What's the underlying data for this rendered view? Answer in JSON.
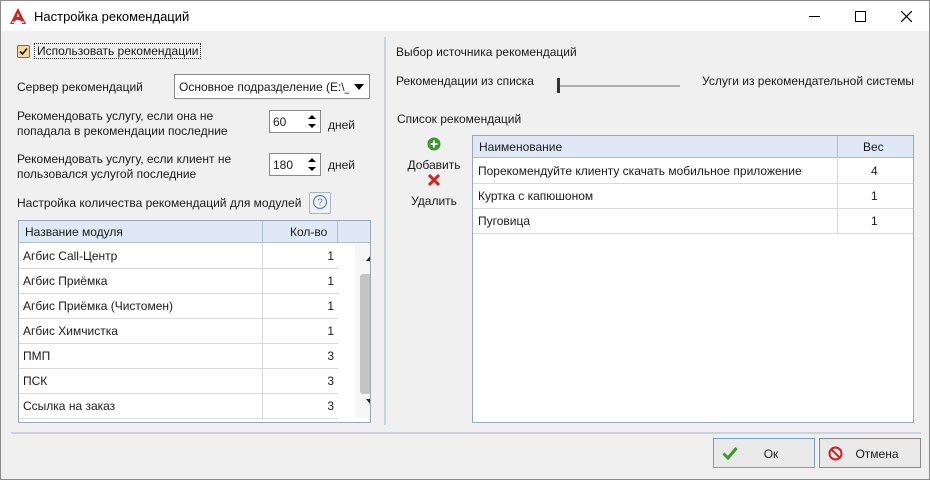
{
  "window": {
    "title": "Настройка рекомендаций",
    "icon": "red-a-logo-icon",
    "controls": [
      "minimize-icon",
      "maximize-icon",
      "close-icon"
    ]
  },
  "left": {
    "use_recommendations": {
      "label": "Использовать рекомендации",
      "checked": true
    },
    "server": {
      "label": "Сервер рекомендаций",
      "value": "Основное подразделение (E:\\_R"
    },
    "recommend_if_not_recommended": {
      "label_line1": "Рекомендовать услугу, если она не",
      "label_line2": "попадала в рекомендации последние",
      "value": "60",
      "unit": "дней"
    },
    "recommend_if_not_used": {
      "label_line1": "Рекомендовать услугу, если клиент не",
      "label_line2": "пользовался услугой последние",
      "value": "180",
      "unit": "дней"
    },
    "modules_settings_label": "Настройка количества рекомендаций для модулей",
    "help_icon": "question-circle-icon",
    "modules_grid": {
      "columns": [
        "Название модуля",
        "Кол-во"
      ],
      "rows": [
        {
          "name": "Агбис Call-Центр",
          "count": "1"
        },
        {
          "name": "Агбис Приёмка",
          "count": "1"
        },
        {
          "name": "Агбис Приёмка (Чистомен)",
          "count": "1"
        },
        {
          "name": "Агбис Химчистка",
          "count": "1"
        },
        {
          "name": "ПМП",
          "count": "3"
        },
        {
          "name": "ПСК",
          "count": "3"
        },
        {
          "name": "Ссылка на заказ",
          "count": "3"
        }
      ]
    }
  },
  "right": {
    "source_label": "Выбор источника рекомендаций",
    "slider_left_label": "Рекомендации из списка",
    "slider_right_label": "Услуги из рекомендательной системы",
    "slider_value": 0,
    "list_label": "Список рекомендаций",
    "add_button": {
      "label": "Добавить",
      "icon": "green-plus-icon"
    },
    "delete_button": {
      "label": "Удалить",
      "icon": "red-x-icon"
    },
    "recommendations_grid": {
      "columns": [
        "Наименование",
        "Вес"
      ],
      "rows": [
        {
          "name": "Порекомендуйте клиенту скачать мобильное приложение",
          "weight": "4"
        },
        {
          "name": "Куртка с капюшоном",
          "weight": "1"
        },
        {
          "name": "Пуговица",
          "weight": "1"
        }
      ]
    }
  },
  "buttons": {
    "ok": {
      "label": "Ок",
      "icon": "green-check-icon"
    },
    "cancel": {
      "label": "Отмена",
      "icon": "red-no-icon"
    }
  },
  "colors": {
    "accent_green": "#3a9a2a",
    "accent_red": "#d42020",
    "grid_header": "#dfe8f5"
  }
}
